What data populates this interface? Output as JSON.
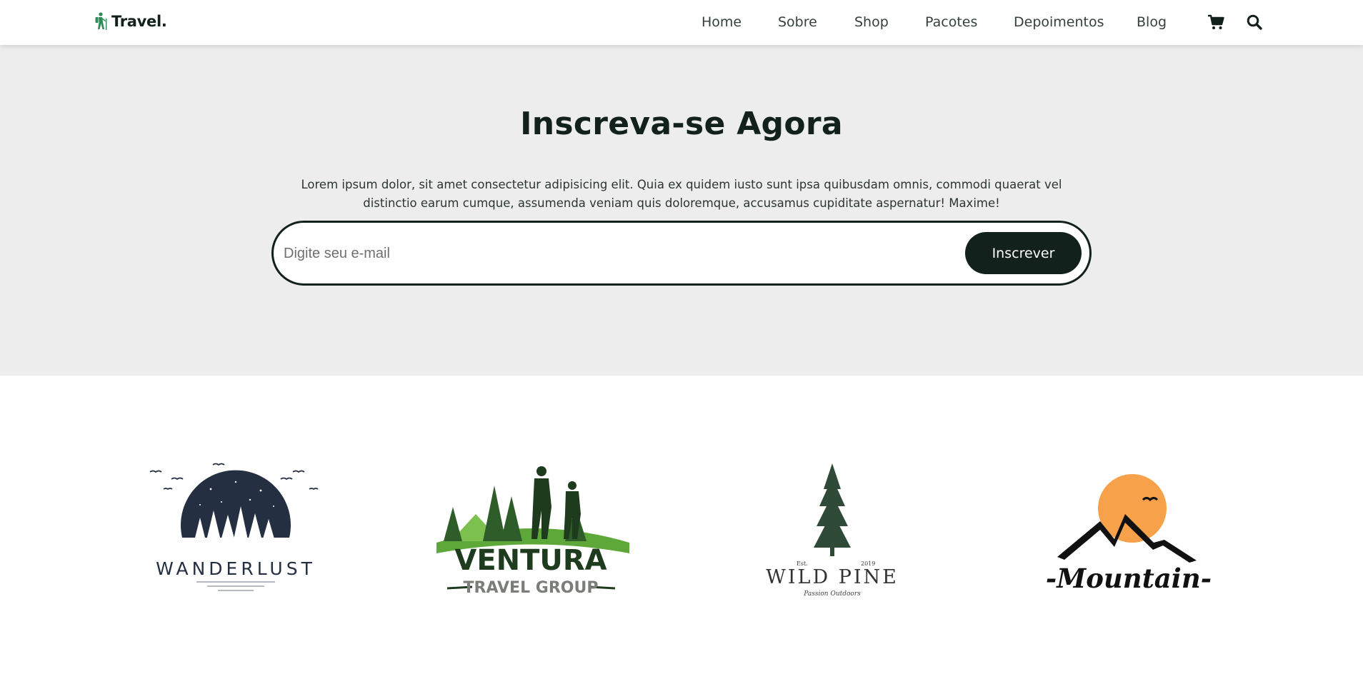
{
  "header": {
    "logo_text": "Travel.",
    "nav": [
      "Home",
      "Sobre",
      "Shop",
      "Pacotes",
      "Depoimentos",
      "Blog"
    ],
    "icons": [
      "cart-icon",
      "search-icon"
    ]
  },
  "newsletter": {
    "title": "Inscreva-se Agora",
    "description": "Lorem ipsum dolor, sit amet consectetur adipisicing elit. Quia ex quidem iusto sunt ipsa quibusdam omnis, commodi quaerat vel distinctio earum cumque, assumenda veniam quis doloremque, accusamus cupiditate aspernatur! Maxime!",
    "input_placeholder": "Digite seu e-mail",
    "button_label": "Inscrever"
  },
  "brands": [
    {
      "name": "wanderlust",
      "text": "WANDERLUST"
    },
    {
      "name": "ventura",
      "text": "VENTURA",
      "subtext": "TRAVEL GROUP"
    },
    {
      "name": "wild-pine",
      "text": "WILD PINE",
      "est": "Est.",
      "year": "2019",
      "tagline": "Passion Outdoors"
    },
    {
      "name": "mountain",
      "text": "-Mountain-"
    }
  ],
  "colors": {
    "brand_green": "#2e8b57",
    "dark": "#13211c",
    "section_bg": "#ededed",
    "sun_orange": "#f7a24a",
    "ventura_green": "#5ea83a",
    "wanderlust_navy": "#243041"
  }
}
